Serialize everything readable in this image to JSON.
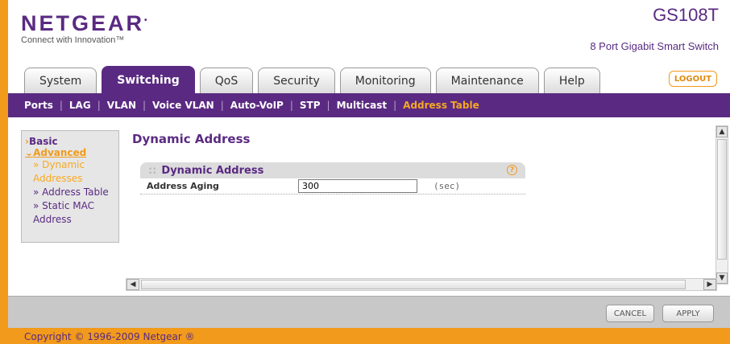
{
  "header": {
    "logo": "NETGEAR",
    "tagline": "Connect with Innovation™",
    "model": "GS108T",
    "model_desc": "8 Port Gigabit Smart Switch"
  },
  "tabs": [
    {
      "label": "System",
      "active": false
    },
    {
      "label": "Switching",
      "active": true
    },
    {
      "label": "QoS",
      "active": false
    },
    {
      "label": "Security",
      "active": false
    },
    {
      "label": "Monitoring",
      "active": false
    },
    {
      "label": "Maintenance",
      "active": false
    },
    {
      "label": "Help",
      "active": false
    }
  ],
  "logout_label": "LOGOUT",
  "submenu": [
    {
      "label": "Ports",
      "active": false
    },
    {
      "label": "LAG",
      "active": false
    },
    {
      "label": "VLAN",
      "active": false
    },
    {
      "label": "Voice VLAN",
      "active": false
    },
    {
      "label": "Auto-VoIP",
      "active": false
    },
    {
      "label": "STP",
      "active": false
    },
    {
      "label": "Multicast",
      "active": false
    },
    {
      "label": "Address Table",
      "active": true
    }
  ],
  "leftnav": {
    "basic": "Basic",
    "advanced": "Advanced",
    "items": [
      {
        "label": "Dynamic Addresses",
        "active": true
      },
      {
        "label": "Address Table",
        "active": false
      },
      {
        "label": "Static MAC Address",
        "active": false
      }
    ]
  },
  "page_title": "Dynamic Address",
  "section": {
    "title": "Dynamic Address",
    "help_icon": "?",
    "row_label": "Address Aging",
    "row_value": "300",
    "row_unit": "(sec)"
  },
  "buttons": {
    "cancel": "CANCEL",
    "apply": "APPLY"
  },
  "footer": "Copyright © 1996-2009 Netgear ®",
  "colors": {
    "brand_purple": "#5a2a82",
    "accent_orange": "#f19a1b"
  }
}
